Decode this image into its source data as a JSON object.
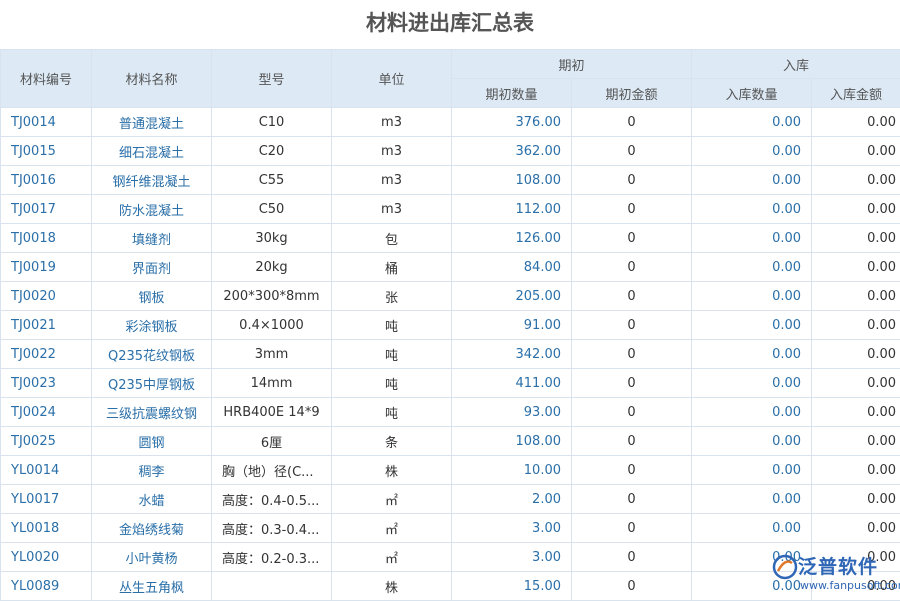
{
  "title": "材料进出库汇总表",
  "headers": {
    "code": "材料编号",
    "name": "材料名称",
    "model": "型号",
    "unit": "单位",
    "opening_group": "期初",
    "opening_qty": "期初数量",
    "opening_amount": "期初金额",
    "inbound_group": "入库",
    "inbound_qty": "入库数量",
    "inbound_amount": "入库金额"
  },
  "rows": [
    {
      "code": "TJ0014",
      "name": "普通混凝土",
      "model": "C10",
      "unit": "m3",
      "opening_qty": "376.00",
      "opening_amount": "0",
      "inbound_qty": "0.00",
      "inbound_amount": "0.00"
    },
    {
      "code": "TJ0015",
      "name": "细石混凝土",
      "model": "C20",
      "unit": "m3",
      "opening_qty": "362.00",
      "opening_amount": "0",
      "inbound_qty": "0.00",
      "inbound_amount": "0.00"
    },
    {
      "code": "TJ0016",
      "name": "钢纤维混凝土",
      "model": "C55",
      "unit": "m3",
      "opening_qty": "108.00",
      "opening_amount": "0",
      "inbound_qty": "0.00",
      "inbound_amount": "0.00"
    },
    {
      "code": "TJ0017",
      "name": "防水混凝土",
      "model": "C50",
      "unit": "m3",
      "opening_qty": "112.00",
      "opening_amount": "0",
      "inbound_qty": "0.00",
      "inbound_amount": "0.00"
    },
    {
      "code": "TJ0018",
      "name": "填缝剂",
      "model": "30kg",
      "unit": "包",
      "opening_qty": "126.00",
      "opening_amount": "0",
      "inbound_qty": "0.00",
      "inbound_amount": "0.00"
    },
    {
      "code": "TJ0019",
      "name": "界面剂",
      "model": "20kg",
      "unit": "桶",
      "opening_qty": "84.00",
      "opening_amount": "0",
      "inbound_qty": "0.00",
      "inbound_amount": "0.00"
    },
    {
      "code": "TJ0020",
      "name": "钢板",
      "model": "200*300*8mm",
      "unit": "张",
      "opening_qty": "205.00",
      "opening_amount": "0",
      "inbound_qty": "0.00",
      "inbound_amount": "0.00"
    },
    {
      "code": "TJ0021",
      "name": "彩涂钢板",
      "model": "0.4×1000",
      "unit": "吨",
      "opening_qty": "91.00",
      "opening_amount": "0",
      "inbound_qty": "0.00",
      "inbound_amount": "0.00"
    },
    {
      "code": "TJ0022",
      "name": "Q235花纹钢板",
      "model": "3mm",
      "unit": "吨",
      "opening_qty": "342.00",
      "opening_amount": "0",
      "inbound_qty": "0.00",
      "inbound_amount": "0.00"
    },
    {
      "code": "TJ0023",
      "name": "Q235中厚钢板",
      "model": "14mm",
      "unit": "吨",
      "opening_qty": "411.00",
      "opening_amount": "0",
      "inbound_qty": "0.00",
      "inbound_amount": "0.00"
    },
    {
      "code": "TJ0024",
      "name": "三级抗震螺纹钢",
      "model": "HRB400E 14*9",
      "unit": "吨",
      "opening_qty": "93.00",
      "opening_amount": "0",
      "inbound_qty": "0.00",
      "inbound_amount": "0.00"
    },
    {
      "code": "TJ0025",
      "name": "圆钢",
      "model": "6厘",
      "unit": "条",
      "opening_qty": "108.00",
      "opening_amount": "0",
      "inbound_qty": "0.00",
      "inbound_amount": "0.00"
    },
    {
      "code": "YL0014",
      "name": "稠李",
      "model": "胸（地）径(C...",
      "unit": "株",
      "opening_qty": "10.00",
      "opening_amount": "0",
      "inbound_qty": "0.00",
      "inbound_amount": "0.00"
    },
    {
      "code": "YL0017",
      "name": "水蜡",
      "model": "高度：0.4-0.5...",
      "unit": "㎡",
      "opening_qty": "2.00",
      "opening_amount": "0",
      "inbound_qty": "0.00",
      "inbound_amount": "0.00"
    },
    {
      "code": "YL0018",
      "name": "金焰绣线菊",
      "model": "高度：0.3-0.4...",
      "unit": "㎡",
      "opening_qty": "3.00",
      "opening_amount": "0",
      "inbound_qty": "0.00",
      "inbound_amount": "0.00"
    },
    {
      "code": "YL0020",
      "name": "小叶黄杨",
      "model": "高度：0.2-0.3...",
      "unit": "㎡",
      "opening_qty": "3.00",
      "opening_amount": "0",
      "inbound_qty": "0.00",
      "inbound_amount": "0.00"
    },
    {
      "code": "YL0089",
      "name": "丛生五角枫",
      "model": "",
      "unit": "株",
      "opening_qty": "15.00",
      "opening_amount": "0",
      "inbound_qty": "0.00",
      "inbound_amount": "0.00"
    }
  ],
  "watermark": {
    "name": "泛普软件",
    "url": "www.fanpusoft.com"
  },
  "colors": {
    "header_bg": "#ddeaf6",
    "link_blue": "#2a6fa8",
    "border": "#d9e3ee",
    "watermark_blue": "#2f67b6"
  }
}
